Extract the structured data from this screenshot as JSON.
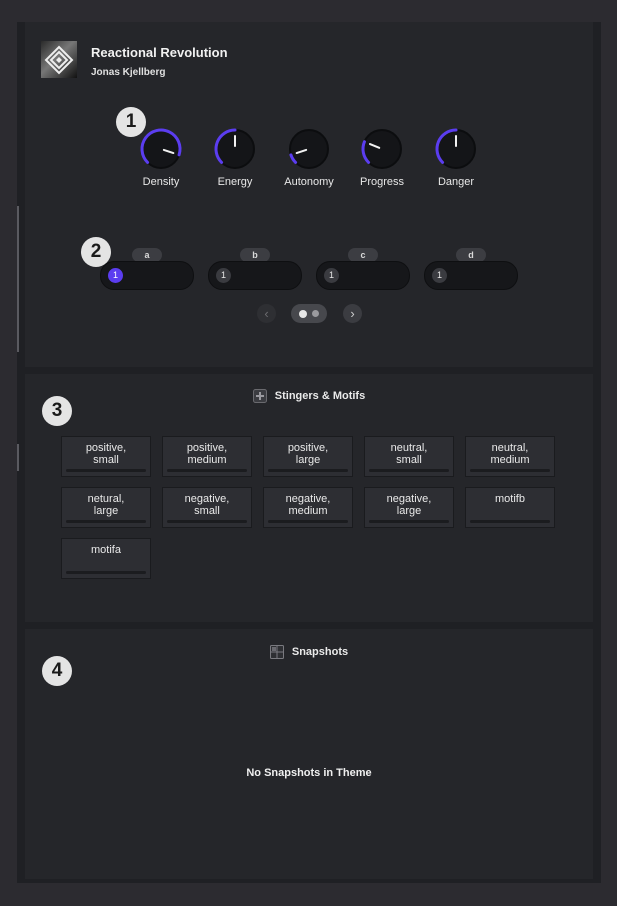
{
  "header": {
    "title": "Reactional Revolution",
    "artist": "Jonas Kjellberg"
  },
  "badges": [
    "1",
    "2",
    "3",
    "4"
  ],
  "knobs": [
    {
      "label": "Density",
      "value": 0.9
    },
    {
      "label": "Energy",
      "value": 0.5
    },
    {
      "label": "Autonomy",
      "value": 0.1
    },
    {
      "label": "Progress",
      "value": 0.25
    },
    {
      "label": "Danger",
      "value": 0.5
    }
  ],
  "slots": [
    {
      "tag": "a",
      "count": "1",
      "active": true
    },
    {
      "tag": "b",
      "count": "1",
      "active": false
    },
    {
      "tag": "c",
      "count": "1",
      "active": false
    },
    {
      "tag": "d",
      "count": "1",
      "active": false
    }
  ],
  "pager": {
    "prev": "‹",
    "next": "›",
    "pages": 2,
    "current": 1
  },
  "stingers": {
    "title": "Stingers & Motifs",
    "items": [
      "positive,\nsmall",
      "positive,\nmedium",
      "positive,\nlarge",
      "neutral,\nsmall",
      "neutral,\nmedium",
      "netural,\nlarge",
      "negative,\nsmall",
      "negative,\nmedium",
      "negative,\nlarge",
      "motifb",
      "motifa"
    ]
  },
  "snapshots": {
    "title": "Snapshots",
    "empty_text": "No Snapshots in Theme"
  },
  "colors": {
    "accent": "#5b3df0",
    "knob_bg": "#141518",
    "panel": "#25262a"
  }
}
